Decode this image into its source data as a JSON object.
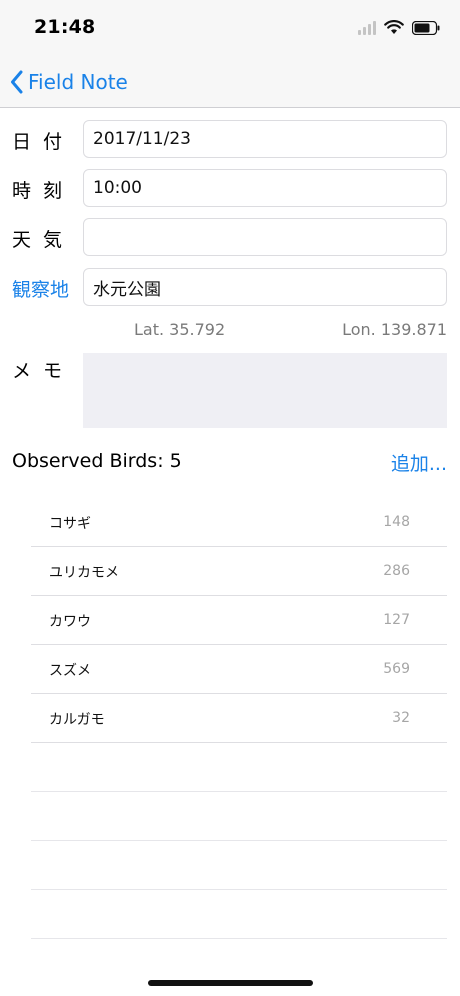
{
  "status_bar": {
    "time": "21:48",
    "icons": [
      "cellular-signal-icon",
      "wifi-icon",
      "battery-icon"
    ]
  },
  "nav": {
    "back_label": "Field Note",
    "back_icon": "chevron-left-icon"
  },
  "form": {
    "date_label": "日付",
    "date_value": "2017/11/23",
    "time_label": "時刻",
    "time_value": "10:00",
    "weather_label": "天気",
    "weather_value": "",
    "location_label": "観察地",
    "location_value": "水元公園",
    "lat_text": "Lat. 35.792",
    "lon_text": "Lon. 139.871",
    "memo_label": "メモ",
    "memo_value": ""
  },
  "birds": {
    "title": "Observed Birds: ",
    "count": "5",
    "add_label": "追加..."
  },
  "bird_list": [
    {
      "name": "コサギ",
      "value": "148"
    },
    {
      "name": "ユリカモメ",
      "value": "286"
    },
    {
      "name": "カワウ",
      "value": "127"
    },
    {
      "name": "スズメ",
      "value": "569"
    },
    {
      "name": "カルガモ",
      "value": "32"
    }
  ],
  "colors": {
    "accent": "#1a82e8",
    "memo_background": "#efeff4",
    "secondary_text": "#7a7a7a"
  }
}
